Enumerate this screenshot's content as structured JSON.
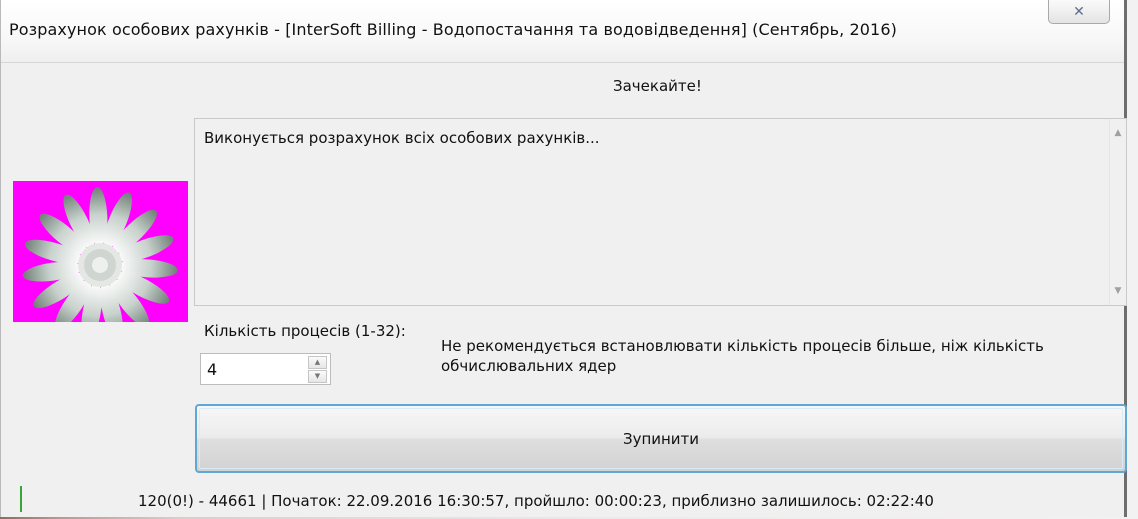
{
  "window": {
    "title": "Розрахунок особових рахунків - [InterSoft Billing - Водопостачання та водовідведення] (Сентябрь, 2016)",
    "close_icon": "close-icon",
    "wait_label": "Зачекайте!"
  },
  "logo": {
    "icon": "daisy-logo-icon",
    "background_color": "#ff00ff"
  },
  "log": {
    "text": "Виконується розрахунок всіх особових рахунків..."
  },
  "processes": {
    "label": "Кількість процесів (1-32):",
    "value": "4",
    "note": "Не рекомендується встановлювати кількість процесів більше, ніж кількість обчислювальних ядер"
  },
  "buttons": {
    "stop_label": "Зупинити"
  },
  "status": {
    "text": "120(0!) - 44661 | Початок: 22.09.2016 16:30:57, пройшло: 00:00:23, приблизно залишилось: 02:22:40"
  },
  "colors": {
    "accent_border": "#5fa8d3",
    "status_indicator": "#3aa33a"
  }
}
